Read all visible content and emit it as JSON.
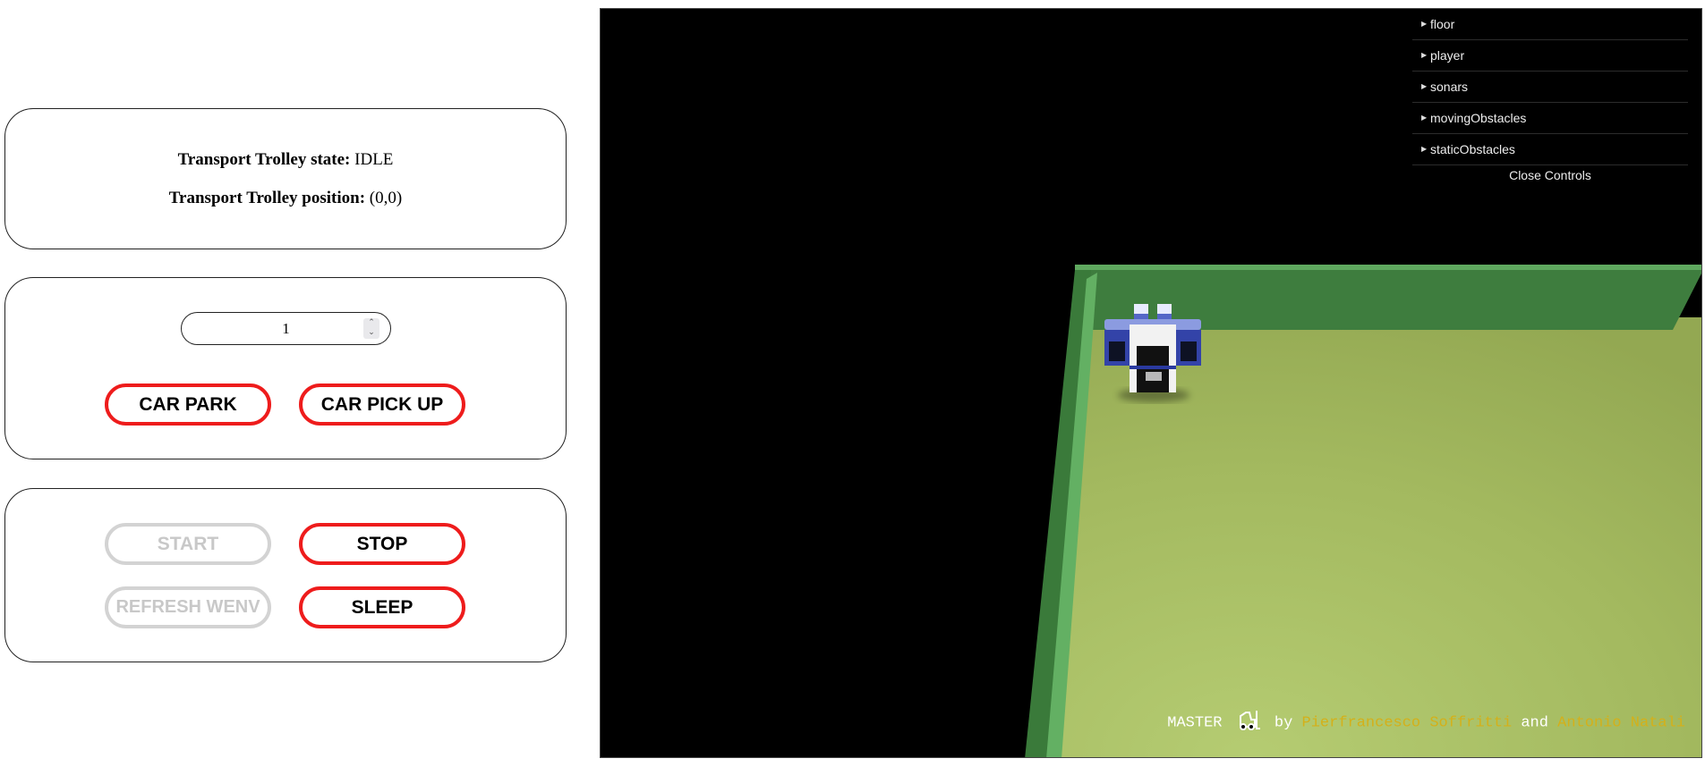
{
  "status": {
    "state_label": "Transport Trolley state:",
    "state_value": "IDLE",
    "position_label": "Transport Trolley position:",
    "position_value": "(0,0)"
  },
  "car_panel": {
    "slot_input_value": "1",
    "car_park_label": "CAR PARK",
    "car_pickup_label": "CAR PICK UP"
  },
  "control_panel": {
    "start_label": "START",
    "stop_label": "STOP",
    "refresh_label": "REFRESH WENV",
    "sleep_label": "SLEEP"
  },
  "scene": {
    "gui": {
      "folders": [
        "floor",
        "player",
        "sonars",
        "movingObstacles",
        "staticObstacles"
      ],
      "close_label": "Close Controls"
    },
    "credits": {
      "prefix": "MASTER",
      "icon": "forklift-icon",
      "by": "by",
      "author1": "Pierfrancesco Soffritti",
      "and": "and",
      "author2": "Antonio Natali"
    },
    "colors": {
      "background": "#000000",
      "floor": "#a6be62",
      "wall": "#3e7d3e",
      "accent_red": "#ee1c1c",
      "author_text": "#d4b01a"
    }
  }
}
